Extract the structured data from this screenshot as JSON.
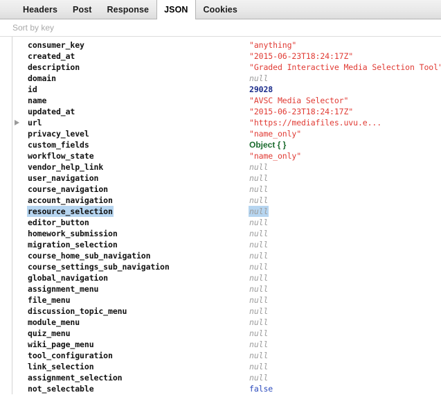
{
  "tabs": [
    {
      "label": "Headers",
      "active": false
    },
    {
      "label": "Post",
      "active": false
    },
    {
      "label": "Response",
      "active": false
    },
    {
      "label": "JSON",
      "active": true
    },
    {
      "label": "Cookies",
      "active": false
    }
  ],
  "filter": {
    "placeholder": "Sort by key",
    "value": ""
  },
  "json_rows": [
    {
      "key": "consumer_key",
      "value": "\"anything\"",
      "type": "string",
      "expandable": false,
      "selected": false
    },
    {
      "key": "created_at",
      "value": "\"2015-06-23T18:24:17Z\"",
      "type": "string",
      "expandable": false,
      "selected": false
    },
    {
      "key": "description",
      "value": "\"Graded Interactive Media Selection Tool\"",
      "type": "string",
      "expandable": false,
      "selected": false
    },
    {
      "key": "domain",
      "value": "null",
      "type": "null",
      "expandable": false,
      "selected": false
    },
    {
      "key": "id",
      "value": "29028",
      "type": "number",
      "expandable": false,
      "selected": false
    },
    {
      "key": "name",
      "value": "\"AVSC Media Selector\"",
      "type": "string",
      "expandable": false,
      "selected": false
    },
    {
      "key": "updated_at",
      "value": "\"2015-06-23T18:24:17Z\"",
      "type": "string",
      "expandable": false,
      "selected": false
    },
    {
      "key": "url",
      "value": "\"https://mediafiles.uvu.e...",
      "type": "string",
      "expandable": true,
      "selected": false
    },
    {
      "key": "privacy_level",
      "value": "\"name_only\"",
      "type": "string",
      "expandable": false,
      "selected": false
    },
    {
      "key": "custom_fields",
      "value": "Object {  }",
      "type": "object",
      "expandable": false,
      "selected": false
    },
    {
      "key": "workflow_state",
      "value": "\"name_only\"",
      "type": "string",
      "expandable": false,
      "selected": false
    },
    {
      "key": "vendor_help_link",
      "value": "null",
      "type": "null",
      "expandable": false,
      "selected": false
    },
    {
      "key": "user_navigation",
      "value": "null",
      "type": "null",
      "expandable": false,
      "selected": false
    },
    {
      "key": "course_navigation",
      "value": "null",
      "type": "null",
      "expandable": false,
      "selected": false
    },
    {
      "key": "account_navigation",
      "value": "null",
      "type": "null",
      "expandable": false,
      "selected": false
    },
    {
      "key": "resource_selection",
      "value": "null",
      "type": "null",
      "expandable": false,
      "selected": true
    },
    {
      "key": "editor_button",
      "value": "null",
      "type": "null",
      "expandable": false,
      "selected": false
    },
    {
      "key": "homework_submission",
      "value": "null",
      "type": "null",
      "expandable": false,
      "selected": false
    },
    {
      "key": "migration_selection",
      "value": "null",
      "type": "null",
      "expandable": false,
      "selected": false
    },
    {
      "key": "course_home_sub_navigation",
      "value": "null",
      "type": "null",
      "expandable": false,
      "selected": false
    },
    {
      "key": "course_settings_sub_navigation",
      "value": "null",
      "type": "null",
      "expandable": false,
      "selected": false
    },
    {
      "key": "global_navigation",
      "value": "null",
      "type": "null",
      "expandable": false,
      "selected": false
    },
    {
      "key": "assignment_menu",
      "value": "null",
      "type": "null",
      "expandable": false,
      "selected": false
    },
    {
      "key": "file_menu",
      "value": "null",
      "type": "null",
      "expandable": false,
      "selected": false
    },
    {
      "key": "discussion_topic_menu",
      "value": "null",
      "type": "null",
      "expandable": false,
      "selected": false
    },
    {
      "key": "module_menu",
      "value": "null",
      "type": "null",
      "expandable": false,
      "selected": false
    },
    {
      "key": "quiz_menu",
      "value": "null",
      "type": "null",
      "expandable": false,
      "selected": false
    },
    {
      "key": "wiki_page_menu",
      "value": "null",
      "type": "null",
      "expandable": false,
      "selected": false
    },
    {
      "key": "tool_configuration",
      "value": "null",
      "type": "null",
      "expandable": false,
      "selected": false
    },
    {
      "key": "link_selection",
      "value": "null",
      "type": "null",
      "expandable": false,
      "selected": false
    },
    {
      "key": "assignment_selection",
      "value": "null",
      "type": "null",
      "expandable": false,
      "selected": false
    },
    {
      "key": "not_selectable",
      "value": "false",
      "type": "bool",
      "expandable": false,
      "selected": false
    }
  ],
  "colors": {
    "string": "#e03a33",
    "null": "#9c9c9c",
    "number": "#1c2d8c",
    "bool": "#2c4bbd",
    "object": "#1b6b2e",
    "selection": "#b6d5f0"
  }
}
